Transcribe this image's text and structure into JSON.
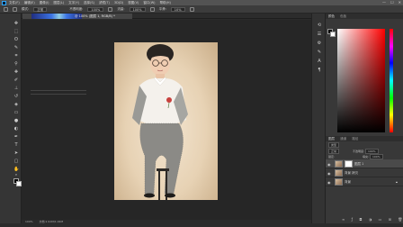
{
  "menubar": {
    "items": [
      "文件(F)",
      "编辑(E)",
      "图像(I)",
      "图层(L)",
      "文字(Y)",
      "选择(S)",
      "滤镜(T)",
      "3D(D)",
      "视图(V)",
      "窗口(W)",
      "帮助(H)"
    ],
    "window_controls": [
      "—",
      "☐",
      "✕"
    ]
  },
  "options": {
    "mode_label": "模式:",
    "mode_value": "正常",
    "opacity_label": "不透明度:",
    "opacity_value": "100%",
    "flow_label": "流量:",
    "flow_value": "100%",
    "smooth_label": "平滑:",
    "smooth_value": "10%"
  },
  "document": {
    "tab_title": "@ 100% (图层 1, RGB/8) *"
  },
  "status": {
    "zoom": "100%",
    "info": "文档:1.91M/1.91M"
  },
  "panels": {
    "color_tab": "颜色",
    "color_tab2": "色板",
    "layers_tab": "图层",
    "channels_tab": "通道",
    "paths_tab": "路径",
    "kind_label": "类型",
    "blend_value": "正常",
    "opacity_label": "不透明度:",
    "opacity_value": "100%",
    "lock_label": "锁定:",
    "fill_label": "填充:",
    "fill_value": "100%"
  },
  "layers": [
    {
      "name": "图层 1",
      "selected": true,
      "has_mask": true
    },
    {
      "name": "背景 拷贝",
      "selected": false,
      "has_mask": false
    },
    {
      "name": "背景",
      "selected": false,
      "has_mask": false
    }
  ],
  "icons": {
    "tools": [
      "move-icon",
      "marquee-icon",
      "lasso-icon",
      "quick-select-icon",
      "crop-icon",
      "eyedropper-icon",
      "healing-icon",
      "brush-icon",
      "stamp-icon",
      "history-brush-icon",
      "eraser-icon",
      "gradient-icon",
      "blur-icon",
      "dodge-icon",
      "pen-icon",
      "text-icon",
      "path-select-icon",
      "shape-icon",
      "hand-icon",
      "zoom-icon"
    ]
  },
  "colors": {
    "foreground": "#000000",
    "background": "#ffffff",
    "accent": "#31a8ff"
  }
}
